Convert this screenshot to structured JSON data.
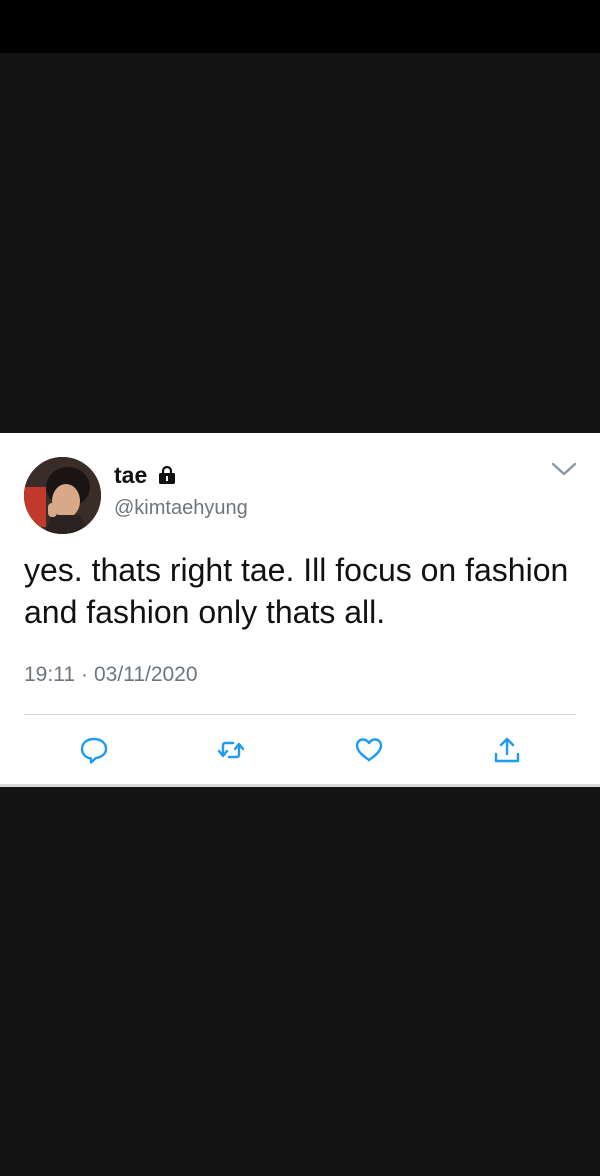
{
  "tweet": {
    "display_name": "tae",
    "handle": "@kimtaehyung",
    "text": "yes. thats right tae. Ill focus on fashion and fashion only thats all.",
    "time": "19:11",
    "separator": "·",
    "date": "03/11/2020",
    "protected": true
  },
  "icons": {
    "lock": "lock-icon",
    "menu": "chevron-down-icon",
    "reply": "reply-icon",
    "retweet": "retweet-icon",
    "like": "heart-icon",
    "share": "share-icon"
  },
  "colors": {
    "background": "#131313",
    "top_bar": "#000000",
    "card": "#ffffff",
    "text": "#111111",
    "secondary_text": "#6e767d",
    "action_icon": "#1d9bf0",
    "divider": "#cfd9de"
  }
}
